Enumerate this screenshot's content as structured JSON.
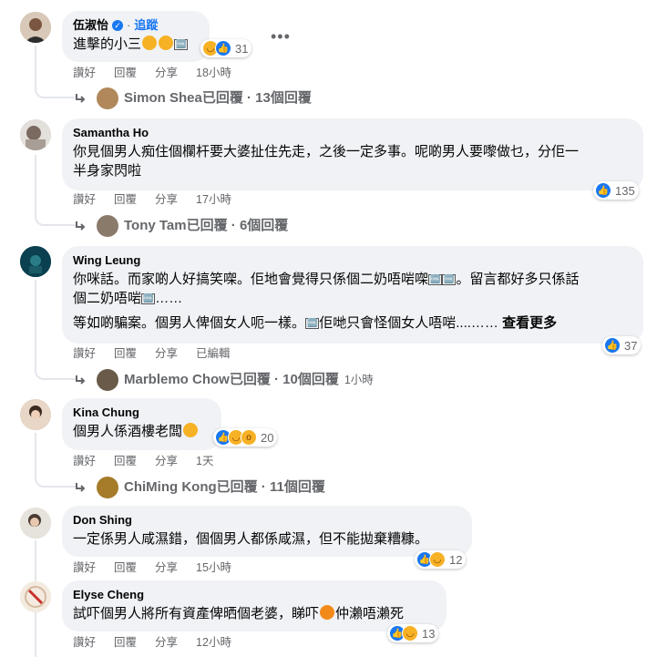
{
  "comments": [
    {
      "name": "伍淑怡",
      "verified": true,
      "follow_label": "追蹤",
      "text": "進擊的小三",
      "box_glyph": "🆒",
      "reaction_count": "31",
      "actions": [
        "讚好",
        "回覆",
        "分享"
      ],
      "time": "18小時",
      "replies_label": "Simon Shea已回覆 · 13個回覆"
    },
    {
      "name": "Samantha Ho",
      "text_line1": "你見個男人痴住個欄杆要大婆扯住先走，之後一定多事。呢啲男人要嚟做乜，分佢一",
      "text_line2": "半身家閃啦",
      "reaction_count": "135",
      "actions": [
        "讚好",
        "回覆",
        "分享"
      ],
      "time": "17小時",
      "replies_label": "Tony Tam已回覆 · 6個回覆"
    },
    {
      "name": "Wing Leung",
      "text_line1": "你咪話。而家啲人好搞笑㗎。佢地會覺得只係個二奶唔啱㗎",
      "text_line1b": "。留言都好多只係話",
      "text_line2": "個二奶唔啱",
      "text_line2b": "……",
      "text_line3": "等如啲騙案。個男人俾個女人呃一樣。",
      "text_line3b": "佢哋只會怪個女人唔啱....…… ",
      "see_more": "查看更多",
      "reaction_count": "37",
      "actions": [
        "讚好",
        "回覆",
        "分享",
        "已編輯"
      ],
      "replies_label": "Marblemo Chow已回覆 · 10個回覆",
      "replies_time": "1小時"
    },
    {
      "name": "Kina Chung",
      "text": "個男人係酒樓老闆",
      "reaction_count": "20",
      "actions": [
        "讚好",
        "回覆",
        "分享"
      ],
      "time": "1天",
      "replies_label": "ChiMing Kong已回覆 · 11個回覆"
    },
    {
      "name": "Don Shing",
      "text": "一定係男人咸濕錯，個個男人都係咸濕，但不能拋棄糟糠。",
      "reaction_count": "12",
      "actions": [
        "讚好",
        "回覆",
        "分享"
      ],
      "time": "15小時"
    },
    {
      "name": "Elyse Cheng",
      "text_a": "試吓個男人將所有資產俾晒個老婆，睇吓",
      "text_b": "仲瀨唔瀨死",
      "reaction_count": "13",
      "actions": [
        "讚好",
        "回覆",
        "分享"
      ],
      "time": "12小時"
    }
  ],
  "more_options_icon": "more-horizontal-icon",
  "colors": {
    "bubble": "#f0f2f5",
    "accent": "#1877f2",
    "meta": "#65676b"
  }
}
